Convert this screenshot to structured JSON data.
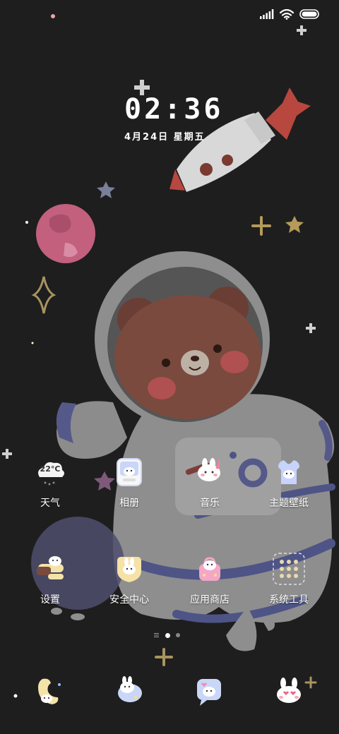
{
  "clock": {
    "time": "02:36",
    "date": "4月24日  星期五"
  },
  "status_bar": {
    "signal_icon": "signal-icon",
    "wifi_icon": "wifi-icon",
    "battery_icon": "battery-icon"
  },
  "weather_widget": {
    "temperature": "22°C"
  },
  "apps_row1": [
    {
      "label": "天气",
      "icon": "weather-icon"
    },
    {
      "label": "相册",
      "icon": "gallery-icon"
    },
    {
      "label": "音乐",
      "icon": "music-icon"
    },
    {
      "label": "主题壁纸",
      "icon": "themes-icon"
    }
  ],
  "apps_row2": [
    {
      "label": "设置",
      "icon": "settings-icon"
    },
    {
      "label": "安全中心",
      "icon": "security-icon"
    },
    {
      "label": "应用商店",
      "icon": "app-store-icon"
    },
    {
      "label": "系统工具",
      "icon": "folder-icon"
    }
  ],
  "dock": [
    {
      "icon": "phone-icon"
    },
    {
      "icon": "messages-icon"
    },
    {
      "icon": "browser-icon"
    },
    {
      "icon": "camera-icon"
    }
  ],
  "pages": {
    "current": 1,
    "total": 2
  },
  "colors": {
    "background": "#1e1e1e",
    "bear": "#7a4a3e",
    "suit": "#8e8e8e",
    "planet": "#c2607e"
  }
}
